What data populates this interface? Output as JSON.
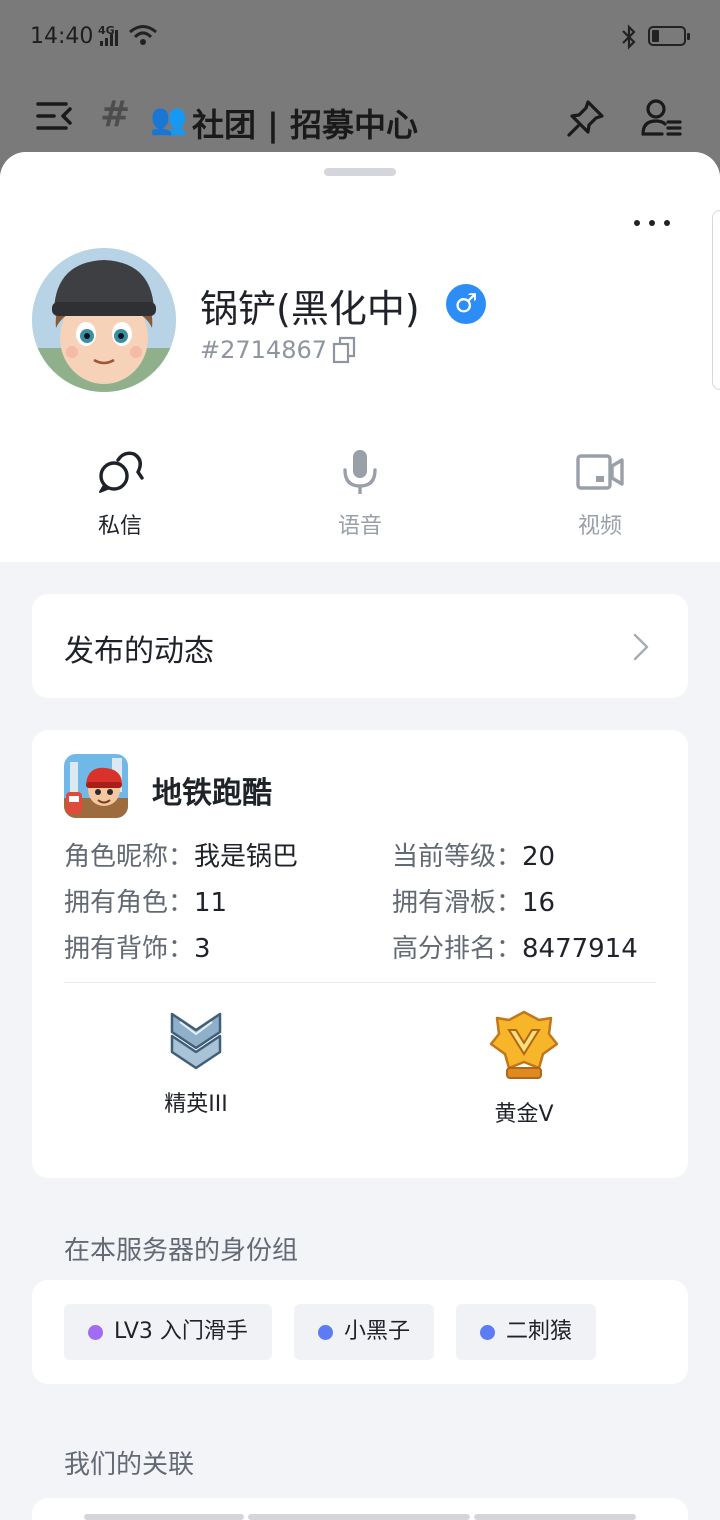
{
  "status_bar": {
    "time": "14:40",
    "network": "4G",
    "icons": [
      "signal-icon",
      "wifi-icon",
      "bluetooth-icon",
      "battery-icon"
    ]
  },
  "channel_header": {
    "hash": "#",
    "people_emoji": "👥",
    "title": "社团 | 招募中心",
    "icons": [
      "menu-collapse-icon",
      "pin-icon",
      "members-icon"
    ]
  },
  "profile": {
    "name": "锅铲(黑化中)",
    "gender_symbol": "♂",
    "id": "#2714867",
    "more_icon": "more-icon"
  },
  "actions": [
    {
      "label": "私信",
      "icon": "chat-icon",
      "enabled": true
    },
    {
      "label": "语音",
      "icon": "microphone-icon",
      "enabled": false
    },
    {
      "label": "视频",
      "icon": "video-icon",
      "enabled": false
    }
  ],
  "posts": {
    "label": "发布的动态"
  },
  "game": {
    "name": "地铁跑酷",
    "stats": [
      {
        "label": "角色昵称：",
        "value": "我是锅巴"
      },
      {
        "label": "当前等级：",
        "value": "20"
      },
      {
        "label": "拥有角色：",
        "value": "11"
      },
      {
        "label": "拥有滑板：",
        "value": "16"
      },
      {
        "label": "拥有背饰：",
        "value": "3"
      },
      {
        "label": "高分排名：",
        "value": "8477914"
      }
    ],
    "ranks": [
      {
        "label": "精英III",
        "icon": "elite-rank-icon"
      },
      {
        "label": "黄金V",
        "icon": "gold-rank-icon"
      }
    ]
  },
  "roles": {
    "title": "在本服务器的身份组",
    "items": [
      {
        "label": "LV3 入门滑手",
        "color": "#a26cf2"
      },
      {
        "label": "小黑子",
        "color": "#5c7cf5"
      },
      {
        "label": "二刺猿",
        "color": "#5c7cf5"
      }
    ]
  },
  "relations": {
    "title": "我们的关联"
  },
  "colors": {
    "accent_blue": "#2b8df5",
    "page_bg": "#f3f4f8",
    "overlay": "#777777"
  }
}
